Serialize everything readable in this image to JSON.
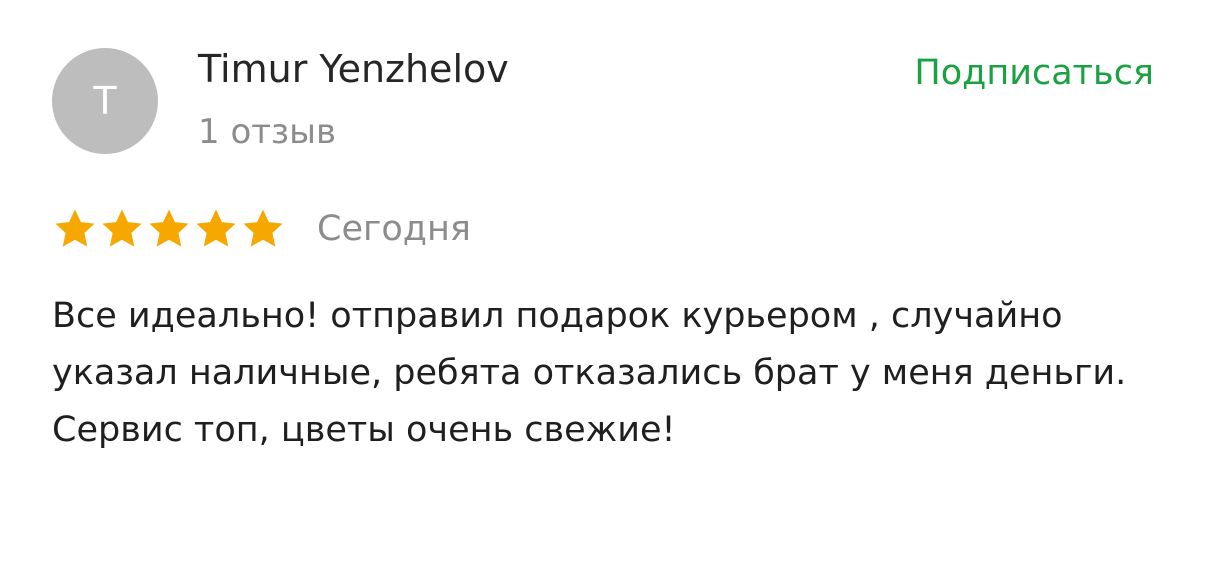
{
  "review": {
    "author": {
      "initial": "T",
      "name": "Timur Yenzhelov",
      "review_count": "1 отзыв"
    },
    "subscribe_label": "Подписаться",
    "rating": {
      "value": 5,
      "max": 5,
      "star_icon": "star-icon",
      "star_color": "#f6a800"
    },
    "date": "Сегодня",
    "text": "Все идеально! отправил подарок курьером , случайно указал наличные, ребята отказались брат у меня деньги. Сервис топ, цветы очень свежие!"
  },
  "colors": {
    "accent": "#1aa242",
    "avatar_bg": "#bdbdbd",
    "muted_text": "#8c8c8c"
  }
}
